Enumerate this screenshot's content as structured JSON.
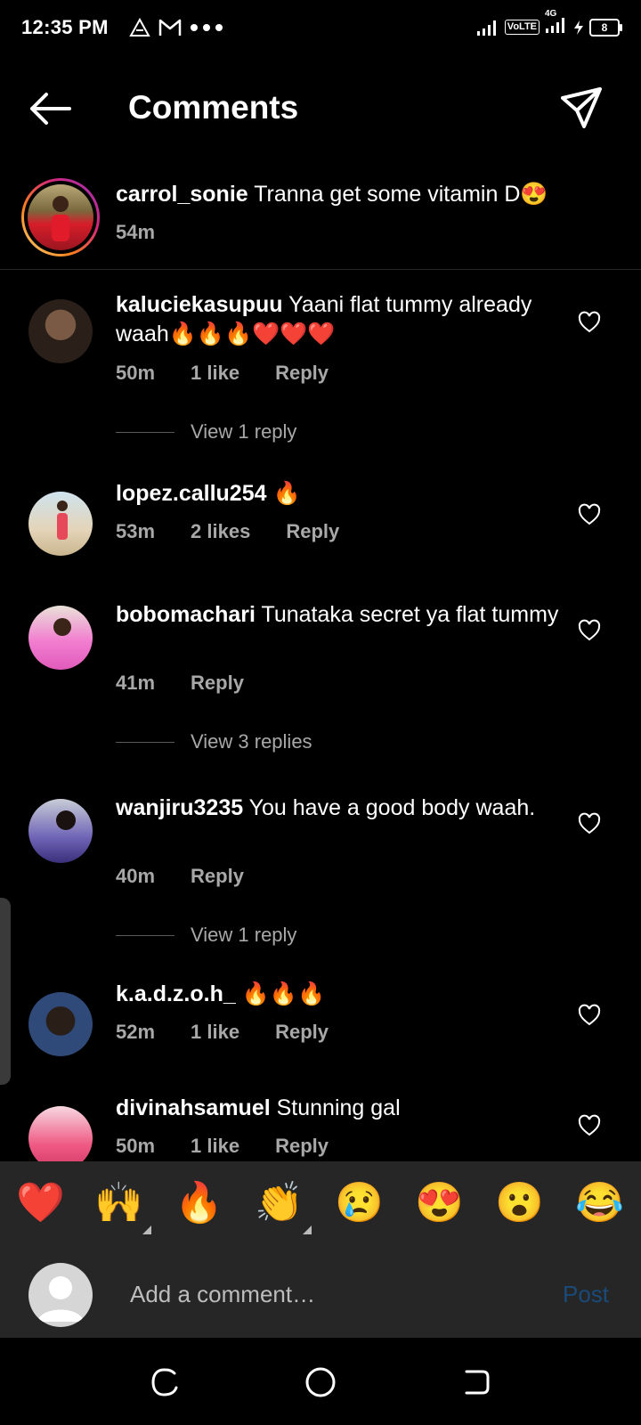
{
  "status_bar": {
    "time": "12:35 PM",
    "network_label": "VoLTE",
    "network_type": "4G",
    "battery_level": "8"
  },
  "header": {
    "title": "Comments",
    "back_icon": "arrow-left-icon",
    "share_icon": "paper-plane-icon"
  },
  "caption": {
    "username": "carrol_sonie",
    "text": "Tranna get some vitamin D😍",
    "time": "54m"
  },
  "comments": [
    {
      "username": "kaluciekasupuu",
      "text": "Yaani flat tummy already  waah🔥🔥🔥❤️❤️❤️",
      "time": "50m",
      "likes": "1 like",
      "reply": "Reply",
      "view_replies": "View 1 reply"
    },
    {
      "username": "lopez.callu254",
      "text": "🔥",
      "time": "53m",
      "likes": "2 likes",
      "reply": "Reply"
    },
    {
      "username": "bobomachari",
      "text": "Tunataka secret ya flat tummy",
      "time": "41m",
      "reply": "Reply",
      "view_replies": "View 3 replies"
    },
    {
      "username": "wanjiru3235",
      "text": "You have a good body waah.",
      "time": "40m",
      "reply": "Reply",
      "view_replies": "View 1 reply"
    },
    {
      "username": "k.a.d.z.o.h_",
      "text": "🔥🔥🔥",
      "time": "52m",
      "likes": "1 like",
      "reply": "Reply"
    },
    {
      "username": "divinahsamuel",
      "text": "Stunning gal",
      "time": "50m",
      "likes": "1 like",
      "reply": "Reply"
    }
  ],
  "emoji_bar": [
    "❤️",
    "🙌",
    "🔥",
    "👏",
    "😢",
    "😍",
    "😮",
    "😂"
  ],
  "composer": {
    "placeholder": "Add a comment…",
    "post_label": "Post"
  },
  "colors": {
    "background": "#000000",
    "secondary_text": "#a8a8a8",
    "panel": "#262626",
    "post_disabled": "#1a4a7a"
  }
}
